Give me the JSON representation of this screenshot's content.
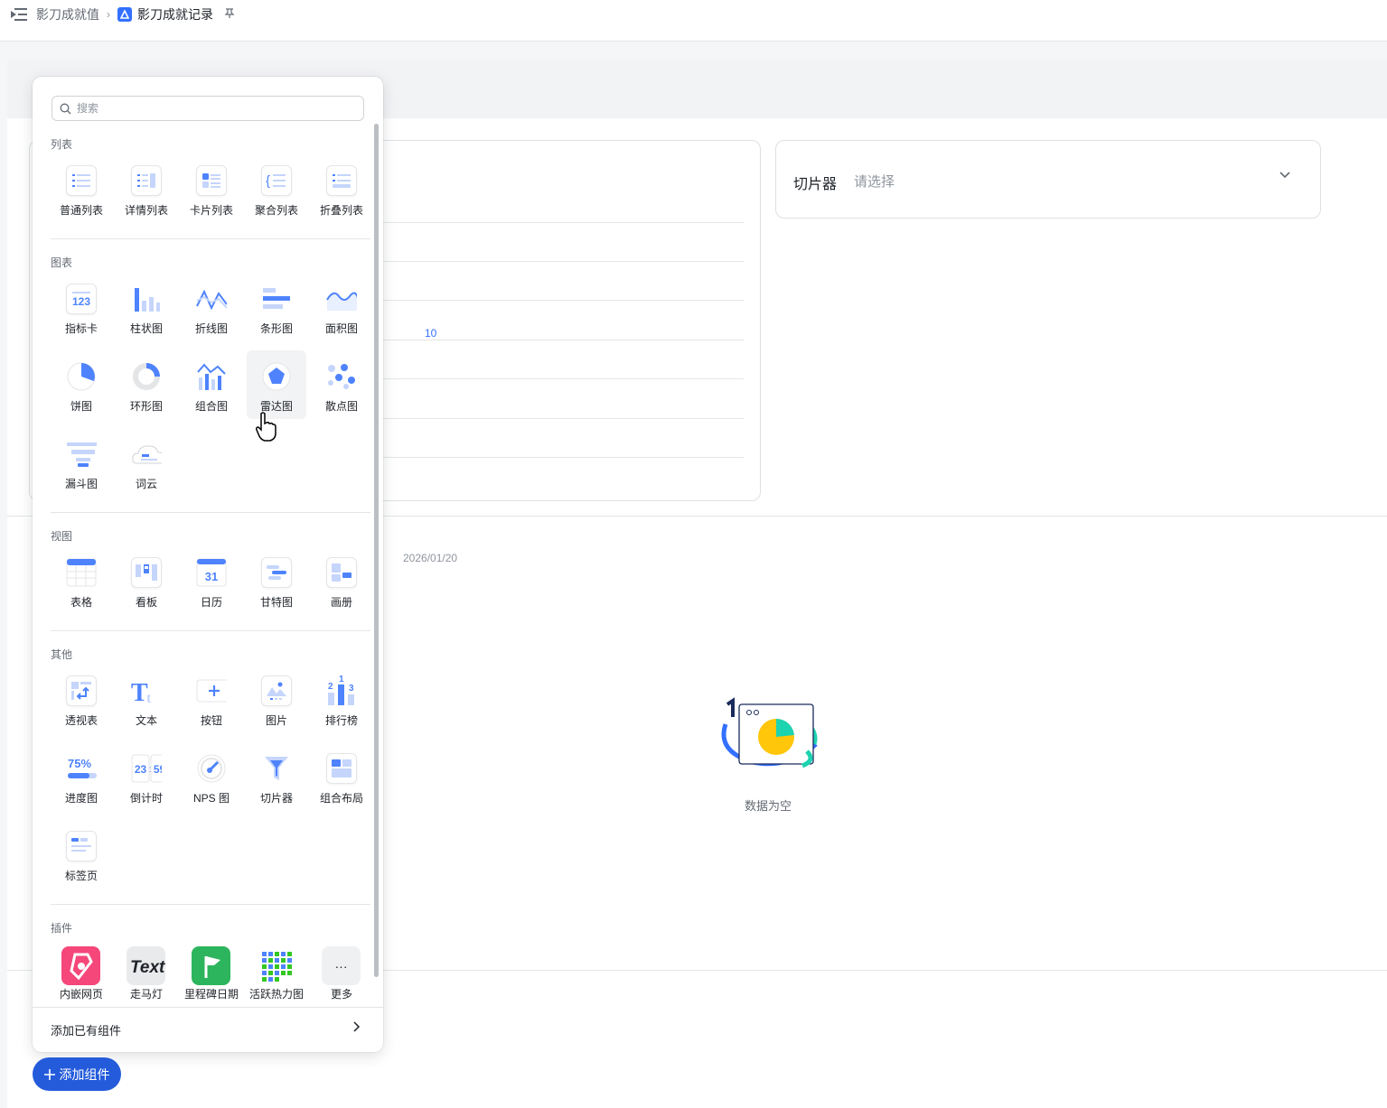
{
  "breadcrumb": {
    "parent": "影刀成就值",
    "current": "影刀成就记录"
  },
  "card_left": {
    "tick_label": "10",
    "date_label": "2026/01/20"
  },
  "slicer": {
    "label": "切片器",
    "placeholder": "请选择"
  },
  "empty": {
    "text": "数据为空"
  },
  "popup": {
    "search_placeholder": "搜索",
    "sections": {
      "list": {
        "title": "列表",
        "items": [
          "普通列表",
          "详情列表",
          "卡片列表",
          "聚合列表",
          "折叠列表"
        ]
      },
      "chart": {
        "title": "图表",
        "items": [
          "指标卡",
          "柱状图",
          "折线图",
          "条形图",
          "面积图",
          "饼图",
          "环形图",
          "组合图",
          "雷达图",
          "散点图",
          "漏斗图",
          "词云"
        ]
      },
      "view": {
        "title": "视图",
        "items": [
          "表格",
          "看板",
          "日历",
          "甘特图",
          "画册"
        ]
      },
      "other": {
        "title": "其他",
        "items": [
          "透视表",
          "文本",
          "按钮",
          "图片",
          "排行榜",
          "进度图",
          "倒计时",
          "NPS 图",
          "切片器",
          "组合布局",
          "标签页"
        ]
      },
      "plugin": {
        "title": "插件",
        "items": [
          "内嵌网页",
          "走马灯",
          "里程碑日期",
          "活跃热力图",
          "更多"
        ]
      }
    },
    "icon_text": {
      "kpi": "123",
      "calendar": "31",
      "progress": "75%",
      "countdown_h": "23",
      "countdown_m": "59",
      "marquee": "Text",
      "more": "···",
      "rank_1": "1",
      "rank_2": "2",
      "rank_3": "3"
    },
    "footer_label": "添加已有组件"
  },
  "add_button": {
    "label": "添加组件"
  },
  "colors": {
    "accent": "#3370ff",
    "button": "#245bdb",
    "icon_blue": "#4e83fd",
    "icon_light": "#c5d5fb"
  }
}
